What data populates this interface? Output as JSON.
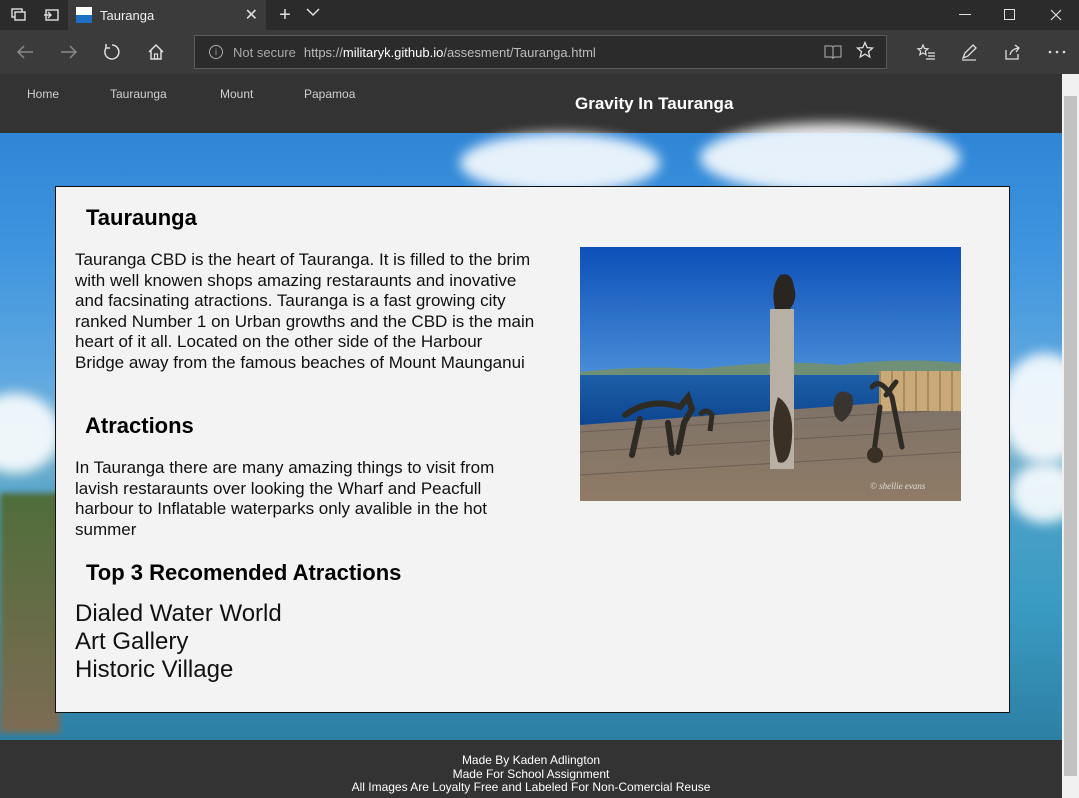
{
  "browser": {
    "tab_title": "Tauranga",
    "tab_close": "✕",
    "new_tab": "+",
    "security_label": "Not secure",
    "url_prefix": "https://",
    "url_host": "militaryk.github.io",
    "url_path": "/assesment/Tauranga.html"
  },
  "site": {
    "nav": [
      "Home",
      "Taurаunga",
      "Mount",
      "Papamoa"
    ],
    "title": "Gravity In Tauranga"
  },
  "content": {
    "heading1": "Taurаunga",
    "para1": "Tauranga CBD is the heart of Tauranga. It is filled to the brim with well knowen shops amazing restaraunts and inovative and facsinating atractions. Tauranga is a fast growing city ranked Number 1 on Urban growths and the CBD is the main heart of it all. Located on the other side of the Harbour Bridge away from the famous beaches of Mount Maunganui",
    "heading2": "Atractions",
    "para2": "In Tauranga there are many amazing things to visit from lavish restaraunts over looking the Wharf and Peacfull harbour to Inflatable waterparks only avalible in the hot summer",
    "heading3": "Top 3 Recomended Atractions",
    "top3": [
      "Dialed Water World",
      "Art Gallery",
      "Historic Village"
    ],
    "photo_watermark": "© shellie evans"
  },
  "footer": {
    "line1": "Made By Kaden Adlington",
    "line2": "Made For School Assignment",
    "line3": "All Images Are Loyalty Free and Labeled For Non-Comercial Reuse"
  }
}
